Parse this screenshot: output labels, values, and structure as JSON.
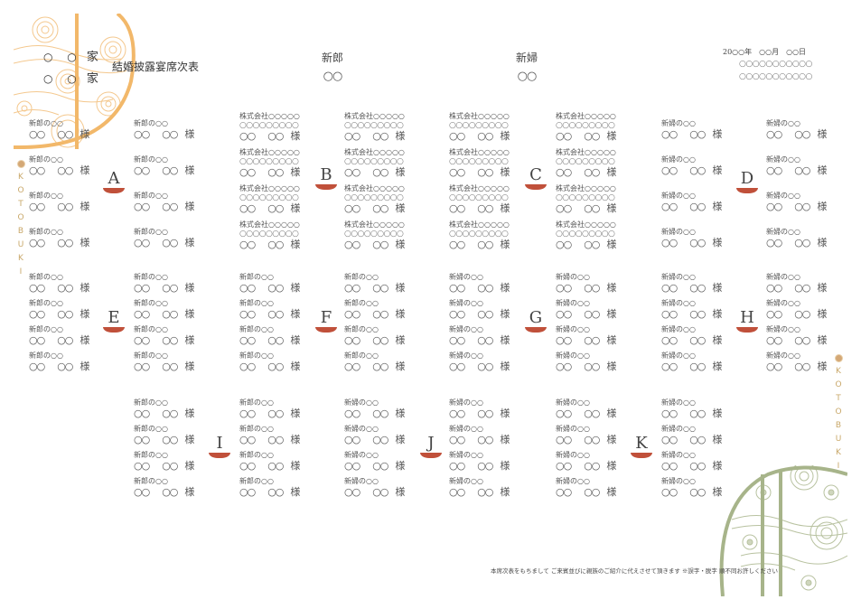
{
  "header": {
    "family_lines": [
      {
        "circles": "○ ○",
        "suffix": "家"
      },
      {
        "circles": "○ ○",
        "suffix": "家"
      }
    ],
    "title": "結婚披露宴席次表",
    "groom": {
      "label": "新郎",
      "name": "○○"
    },
    "bride": {
      "label": "新婦",
      "name": "○○"
    },
    "date": "20○○年　○○月　○○日",
    "venue_lines": [
      "○○○○○○○○○○○",
      "○○○○○○○○○○○"
    ]
  },
  "side_text": "KOTOBUKI",
  "guest_template": {
    "groom_relation": "新郎の○○",
    "bride_relation": "新婦の○○",
    "company": "株式会社○○○○○",
    "department": "○○○○○○○○○",
    "family_name": "○○",
    "given_name": "○○",
    "honorific": "様"
  },
  "tables": [
    {
      "letter": "A",
      "type": "groom"
    },
    {
      "letter": "B",
      "type": "company"
    },
    {
      "letter": "C",
      "type": "company"
    },
    {
      "letter": "D",
      "type": "bride"
    },
    {
      "letter": "E",
      "type": "groom"
    },
    {
      "letter": "F",
      "type": "groom"
    },
    {
      "letter": "G",
      "type": "bride"
    },
    {
      "letter": "H",
      "type": "bride"
    },
    {
      "letter": "I",
      "type": "groom"
    },
    {
      "letter": "J",
      "type": "bride"
    },
    {
      "letter": "K",
      "type": "bride"
    }
  ],
  "footer": "本席次表をもちまして ご来賓並びに親族のご紹介に代えさせて頂きます ※誤字・脱字 順不同お許しください",
  "colors": {
    "accent_red": "#c0503a",
    "orange_deco": "#f2b86a",
    "green_deco": "#a7b48a",
    "gold_text": "#c9a86a"
  }
}
